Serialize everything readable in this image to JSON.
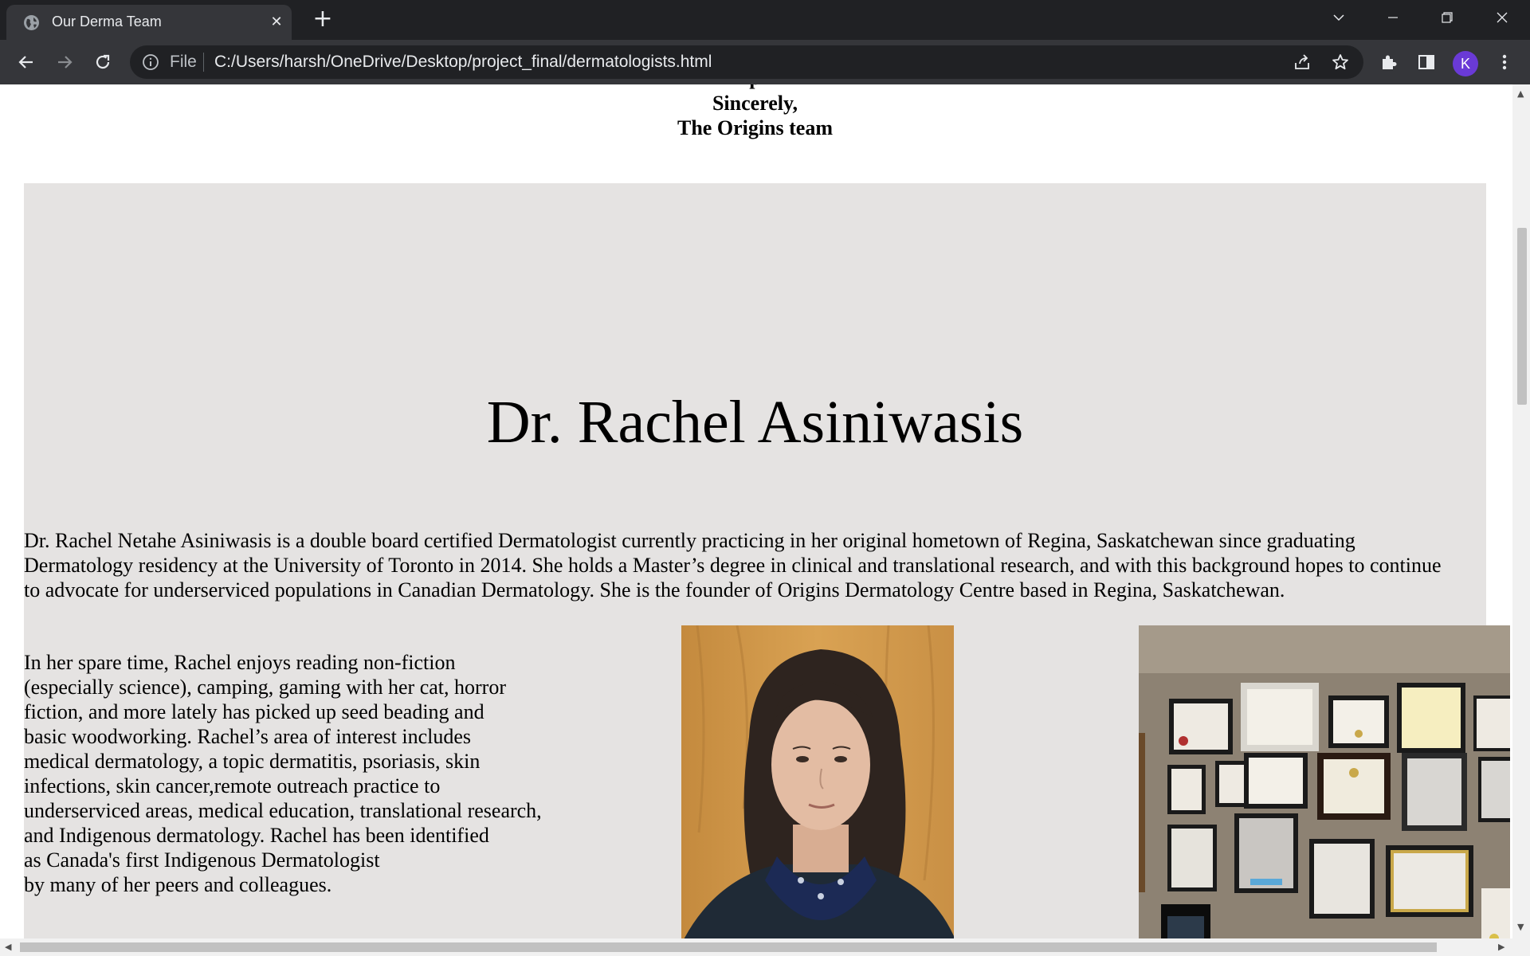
{
  "browser": {
    "tab_title": "Our Derma Team",
    "tab_close": "✕",
    "new_tab": "+",
    "scheme_label": "File",
    "url": "C:/Users/harsh/OneDrive/Desktop/project_final/dermatologists.html",
    "profile_initial": "K",
    "icons": [
      "globe-icon",
      "close-icon",
      "plus-icon",
      "chevron-down-icon",
      "minimize-icon",
      "restore-icon",
      "window-close-icon",
      "back-icon",
      "forward-icon",
      "reload-icon",
      "info-icon",
      "share-icon",
      "star-icon",
      "extensions-icon",
      "side-panel-icon",
      "menu-icon"
    ]
  },
  "page": {
    "signoff_cut": "p",
    "signoff_line1": "Sincerely,",
    "signoff_line2": "The Origins team",
    "doctor_name": "Dr. Rachel Asiniwasis",
    "bio": "Dr. Rachel Netahe Asiniwasis is a double board certified Dermatologist currently practicing in her original hometown of Regina, Saskatchewan since graduating Dermatology residency at the University of Toronto in 2014. She holds a Master’s degree in clinical and translational research, and with this background hopes to continue to advocate for underserviced populations in Canadian Dermatology. She is the founder of Origins Dermatology Centre based in Regina, Saskatchewan.",
    "hobbies_lines": [
      "In her spare time, Rachel enjoys reading non-fiction",
      "(especially science), camping, gaming with her cat, horror",
      "fiction, and more lately has picked up seed beading and",
      "basic woodworking. Rachel’s area of interest includes",
      "medical dermatology, a topic dermatitis, psoriasis, skin",
      "infections, skin cancer,remote outreach practice to",
      "underserviced areas, medical education, translational research,",
      "and Indigenous dermatology. Rachel has been identified",
      "as Canada's first Indigenous Dermatologist",
      "by many of her peers and colleagues."
    ],
    "colors": {
      "panel_background": "#e5e3e2",
      "page_background": "#ffffff",
      "chrome_dark": "#202124",
      "chrome_toolbar": "#35363a",
      "avatar": "#6a3ad6"
    }
  }
}
